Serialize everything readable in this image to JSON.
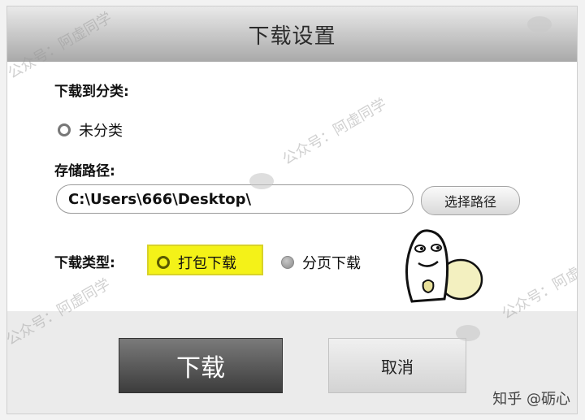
{
  "dialog": {
    "title": "下载设置"
  },
  "category": {
    "label": "下载到分类:",
    "option": "未分类"
  },
  "storage": {
    "label": "存储路径:",
    "path_value": "C:\\Users\\666\\Desktop\\",
    "choose_button": "选择路径"
  },
  "download_type": {
    "label": "下载类型:",
    "options": [
      {
        "label": "打包下载",
        "selected": true
      },
      {
        "label": "分页下载",
        "selected": false
      }
    ]
  },
  "buttons": {
    "download": "下载",
    "cancel": "取消"
  },
  "watermark": {
    "text": "公众号：阿虚同学",
    "credit": "知乎 @砺心"
  },
  "colors": {
    "highlight": "#f4f218",
    "download_button": "#4a4a4a"
  }
}
